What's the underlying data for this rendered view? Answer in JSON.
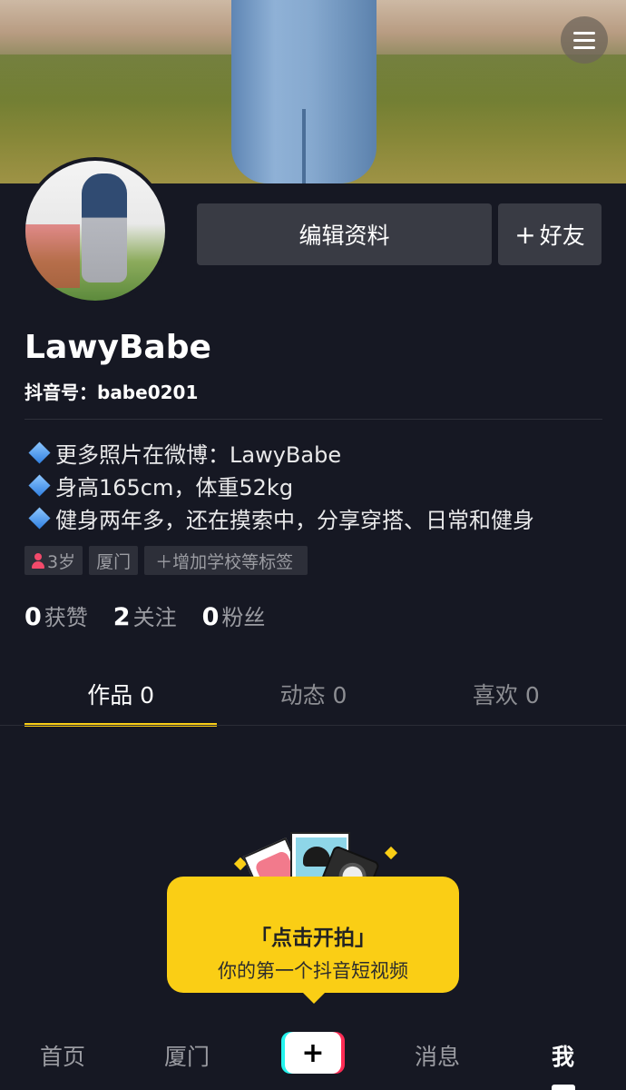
{
  "header": {
    "menu_icon": "hamburger-menu-icon"
  },
  "profile": {
    "username": "LawyBabe",
    "douyin_id": "抖音号：babe0201",
    "edit_label": "编辑资料",
    "add_friend_label": "好友",
    "add_friend_icon": "plus-icon"
  },
  "bio": [
    "更多照片在微博：LawyBabe",
    "身高165cm，体重52kg",
    "健身两年多，还在摸索中，分享穿搭、日常和健身"
  ],
  "tags": {
    "age": "3岁",
    "age_icon": "person-icon",
    "city": "厦门",
    "add": "＋增加学校等标签"
  },
  "stats": [
    {
      "num": "0",
      "label": "获赞"
    },
    {
      "num": "2",
      "label": "关注"
    },
    {
      "num": "0",
      "label": "粉丝"
    }
  ],
  "tabs": [
    {
      "label": "作品 0",
      "active": true
    },
    {
      "label": "动态 0",
      "active": false
    },
    {
      "label": "喜欢 0",
      "active": false
    }
  ],
  "empty_prompt": {
    "title": "「点击开拍」",
    "subtitle": "你的第一个抖音短视频"
  },
  "bottom_nav": {
    "home": "首页",
    "city": "厦门",
    "create_icon": "+",
    "messages": "消息",
    "me": "我"
  },
  "colors": {
    "background": "#161823",
    "accent": "#face15",
    "button": "#393b44"
  }
}
